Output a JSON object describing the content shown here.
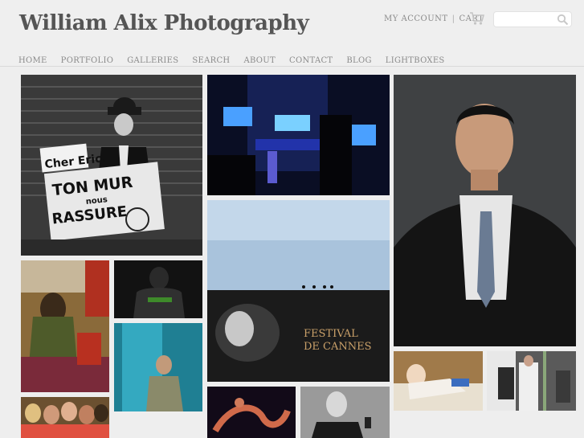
{
  "site": {
    "title": "William Alix Photography"
  },
  "account": {
    "my_account": "MY ACCOUNT",
    "separator": "|",
    "cart": "CART"
  },
  "search": {
    "placeholder": "",
    "icon": "search-icon"
  },
  "nav": [
    {
      "label": "HOME"
    },
    {
      "label": "PORTFOLIO"
    },
    {
      "label": "GALLERIES"
    },
    {
      "label": "SEARCH"
    },
    {
      "label": "ABOUT"
    },
    {
      "label": "CONTACT"
    },
    {
      "label": "BLOG"
    },
    {
      "label": "LIGHTBOXES"
    }
  ],
  "photos": {
    "protest_sign": {
      "line1": "Cher Eric,",
      "line2": "TON MUR",
      "line3": "nous",
      "line4": "RASSURE"
    },
    "cannes_banner": {
      "line1": "FESTIVAL",
      "line2": "DE CANNES"
    }
  },
  "colors": {
    "background": "#eeeeee",
    "title": "#555555",
    "nav": "#8a8a8a"
  }
}
